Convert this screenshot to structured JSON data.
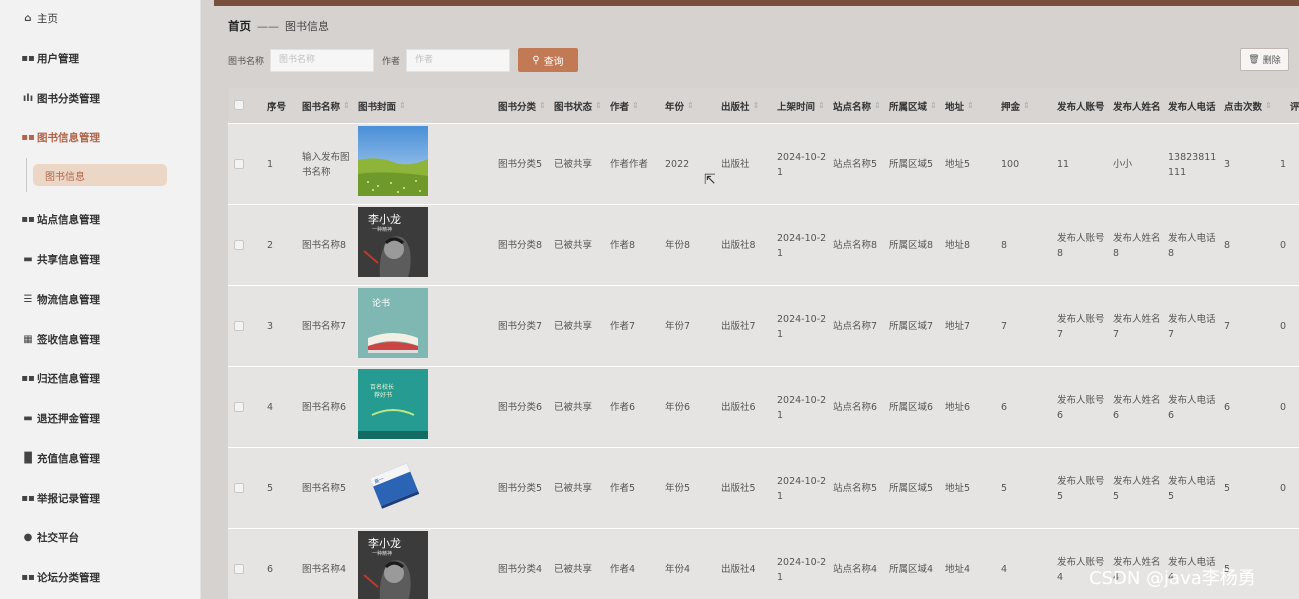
{
  "sidebar": {
    "items": [
      {
        "label": "主页",
        "icon": "home-icon"
      },
      {
        "label": "用户管理",
        "icon": "grid-icon"
      },
      {
        "label": "图书分类管理",
        "icon": "bar-chart-icon"
      },
      {
        "label": "图书信息管理",
        "icon": "grid-icon"
      },
      {
        "label": "站点信息管理",
        "icon": "grid-icon"
      },
      {
        "label": "共享信息管理",
        "icon": "ticket-icon"
      },
      {
        "label": "物流信息管理",
        "icon": "list-icon"
      },
      {
        "label": "签收信息管理",
        "icon": "table-icon"
      },
      {
        "label": "归还信息管理",
        "icon": "grid-icon"
      },
      {
        "label": "退还押金管理",
        "icon": "card-icon"
      },
      {
        "label": "充值信息管理",
        "icon": "bars-icon"
      },
      {
        "label": "举报记录管理",
        "icon": "grid-icon"
      },
      {
        "label": "社交平台",
        "icon": "pin-icon"
      },
      {
        "label": "论坛分类管理",
        "icon": "grid-icon"
      }
    ],
    "sub_item": "图书信息",
    "active_color": "#b0664a"
  },
  "breadcrumb": {
    "home": "首页",
    "separator": "——",
    "current": "图书信息"
  },
  "search": {
    "name_label": "图书名称",
    "name_placeholder": "图书名称",
    "author_label": "作者",
    "author_placeholder": "作者",
    "query_label": "查询"
  },
  "actions": {
    "delete_label": "删除"
  },
  "table": {
    "headers": [
      "序号",
      "图书名称",
      "图书封面",
      "图书分类",
      "图书状态",
      "作者",
      "年份",
      "出版社",
      "上架时间",
      "站点名称",
      "所属区域",
      "地址",
      "押金",
      "发布人账号",
      "发布人姓名",
      "发布人电话",
      "点击次数",
      "评"
    ],
    "rows": [
      {
        "no": "1",
        "name": "输入发布图书名称",
        "cover": "grassland",
        "category": "图书分类5",
        "status": "已被共享",
        "author": "作者作者",
        "year": "2022",
        "publisher": "出版社",
        "time": "2024-10-21",
        "site": "站点名称5",
        "region": "所属区域5",
        "address": "地址5",
        "deposit": "100",
        "account": "11",
        "pname": "小小",
        "phone": "13823811111",
        "clicks": "3",
        "comments": "1"
      },
      {
        "no": "2",
        "name": "图书名称8",
        "cover": "bruce-lee",
        "category": "图书分类8",
        "status": "已被共享",
        "author": "作者8",
        "year": "年份8",
        "publisher": "出版社8",
        "time": "2024-10-21",
        "site": "站点名称8",
        "region": "所属区域8",
        "address": "地址8",
        "deposit": "8",
        "account": "发布人账号8",
        "pname": "发布人姓名8",
        "phone": "发布人电话8",
        "clicks": "8",
        "comments": "0"
      },
      {
        "no": "3",
        "name": "图书名称7",
        "cover": "teal-book",
        "category": "图书分类7",
        "status": "已被共享",
        "author": "作者7",
        "year": "年份7",
        "publisher": "出版社7",
        "time": "2024-10-21",
        "site": "站点名称7",
        "region": "所属区域7",
        "address": "地址7",
        "deposit": "7",
        "account": "发布人账号7",
        "pname": "发布人姓名7",
        "phone": "发布人电话7",
        "clicks": "7",
        "comments": "0"
      },
      {
        "no": "4",
        "name": "图书名称6",
        "cover": "green-book",
        "category": "图书分类6",
        "status": "已被共享",
        "author": "作者6",
        "year": "年份6",
        "publisher": "出版社6",
        "time": "2024-10-21",
        "site": "站点名称6",
        "region": "所属区域6",
        "address": "地址6",
        "deposit": "6",
        "account": "发布人账号6",
        "pname": "发布人姓名6",
        "phone": "发布人电话6",
        "clicks": "6",
        "comments": "0"
      },
      {
        "no": "5",
        "name": "图书名称5",
        "cover": "blue-book",
        "category": "图书分类5",
        "status": "已被共享",
        "author": "作者5",
        "year": "年份5",
        "publisher": "出版社5",
        "time": "2024-10-21",
        "site": "站点名称5",
        "region": "所属区域5",
        "address": "地址5",
        "deposit": "5",
        "account": "发布人账号5",
        "pname": "发布人姓名5",
        "phone": "发布人电话5",
        "clicks": "5",
        "comments": "0"
      },
      {
        "no": "6",
        "name": "图书名称4",
        "cover": "bruce-lee",
        "category": "图书分类4",
        "status": "已被共享",
        "author": "作者4",
        "year": "年份4",
        "publisher": "出版社4",
        "time": "2024-10-21",
        "site": "站点名称4",
        "region": "所属区域4",
        "address": "地址4",
        "deposit": "4",
        "account": "发布人账号4",
        "pname": "发布人姓名4",
        "phone": "发布人电话4",
        "clicks": "5",
        "comments": ""
      }
    ]
  },
  "watermark": "CSDN @java李杨勇"
}
